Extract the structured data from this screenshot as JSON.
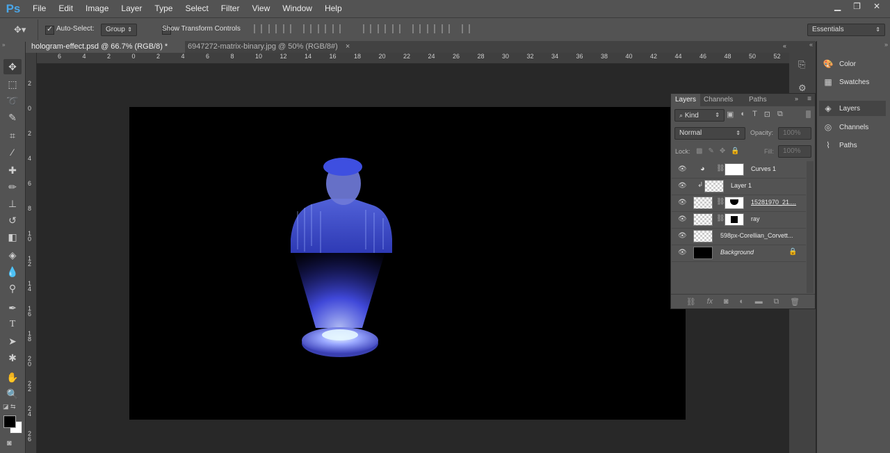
{
  "app": {
    "logo": "Ps"
  },
  "menubar": [
    "File",
    "Edit",
    "Image",
    "Layer",
    "Type",
    "Select",
    "Filter",
    "View",
    "Window",
    "Help"
  ],
  "window_controls": {
    "minimize": "▁",
    "restore": "❐",
    "close": "✕"
  },
  "options": {
    "auto_select_label": "Auto-Select:",
    "auto_select_checked": true,
    "auto_select_value": "Group",
    "show_transform_label": "Show Transform Controls",
    "show_transform_checked": false,
    "workspace": "Essentials"
  },
  "tabs": [
    {
      "label": "hologram-effect.psd @ 66.7% (RGB/8) *",
      "active": true,
      "close": "×"
    },
    {
      "label": "6947272-matrix-binary.jpg @ 50% (RGB/8#)",
      "active": false,
      "close": "×"
    }
  ],
  "ruler": {
    "h_labels": [
      "6",
      "4",
      "2",
      "0",
      "2",
      "4",
      "6",
      "8",
      "10",
      "12",
      "14",
      "16",
      "18",
      "20",
      "22",
      "24",
      "26",
      "28",
      "30",
      "32",
      "34",
      "36",
      "38",
      "40",
      "42",
      "44",
      "46",
      "48",
      "50",
      "52"
    ],
    "v_labels": [
      "2",
      "0",
      "2",
      "4",
      "6",
      "8",
      "1\n0",
      "1\n2",
      "1\n4",
      "1\n6",
      "1\n8",
      "2\n0",
      "2\n2",
      "2\n4",
      "2\n6"
    ]
  },
  "right_panels": [
    {
      "icon": "color-icon",
      "label": "Color"
    },
    {
      "icon": "swatches-icon",
      "label": "Swatches"
    },
    {
      "icon": "layers-icon",
      "label": "Layers"
    },
    {
      "icon": "channels-icon",
      "label": "Channels"
    },
    {
      "icon": "paths-icon",
      "label": "Paths"
    }
  ],
  "layers_panel": {
    "tabs": [
      "Layers",
      "Channels",
      "Paths"
    ],
    "kind_label": "Kind",
    "blend_mode": "Normal",
    "opacity_label": "Opacity:",
    "opacity_value": "100%",
    "lock_label": "Lock:",
    "fill_label": "Fill:",
    "fill_value": "100%",
    "layers": [
      {
        "name": "Curves 1",
        "type": "adjustment",
        "italic": false,
        "underline": false
      },
      {
        "name": "Layer 1",
        "type": "clipped",
        "italic": false,
        "underline": false
      },
      {
        "name": "15281970_21....",
        "type": "masked",
        "italic": false,
        "underline": true
      },
      {
        "name": "ray",
        "type": "masked",
        "italic": false,
        "underline": false
      },
      {
        "name": "598px-Corellian_Corvett...",
        "type": "smart",
        "italic": false,
        "underline": false
      },
      {
        "name": "Background",
        "type": "background",
        "italic": true,
        "underline": false
      }
    ]
  },
  "colors": {
    "hologram_blue": "#3b4cff",
    "ps_logo": "#4aa6e8",
    "canvas": "#000000"
  }
}
